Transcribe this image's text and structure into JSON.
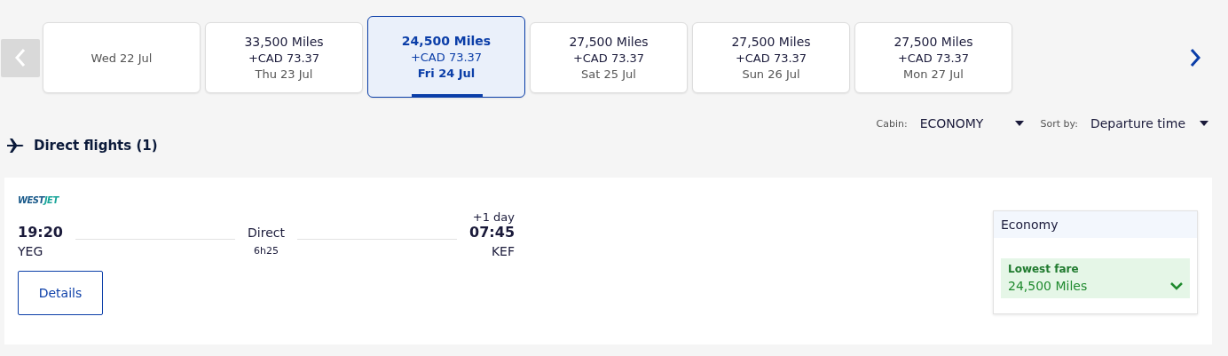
{
  "date_nav": {
    "prev_disabled": true,
    "next_disabled": false
  },
  "dates": [
    {
      "date": "Wed 22 Jul",
      "selected": false
    },
    {
      "miles": "33,500 Miles",
      "fee": "+CAD 73.37",
      "date": "Thu 23 Jul",
      "selected": false
    },
    {
      "miles": "24,500 Miles",
      "fee": "+CAD 73.37",
      "date": "Fri 24 Jul",
      "selected": true
    },
    {
      "miles": "27,500 Miles",
      "fee": "+CAD 73.37",
      "date": "Sat 25 Jul",
      "selected": false
    },
    {
      "miles": "27,500 Miles",
      "fee": "+CAD 73.37",
      "date": "Sun 26 Jul",
      "selected": false
    },
    {
      "miles": "27,500 Miles",
      "fee": "+CAD 73.37",
      "date": "Mon 27 Jul",
      "selected": false
    }
  ],
  "filters": [
    {
      "label": "Cabin:",
      "value": "ECONOMY"
    },
    {
      "label": "Sort by:",
      "value": "Departure time"
    }
  ],
  "section_title": "Direct flights (1)",
  "flight": {
    "airline_logo": {
      "left": "WEST",
      "right": "JET"
    },
    "depart_time": "19:20",
    "depart_airport": "YEG",
    "stops": "Direct",
    "duration": "6h25",
    "day_offset": "+1 day",
    "arrive_time": "07:45",
    "arrive_airport": "KEF",
    "details_button": "Details",
    "fare": {
      "cabin": "Economy",
      "tag": "Lowest fare",
      "price": "24,500 Miles"
    }
  }
}
